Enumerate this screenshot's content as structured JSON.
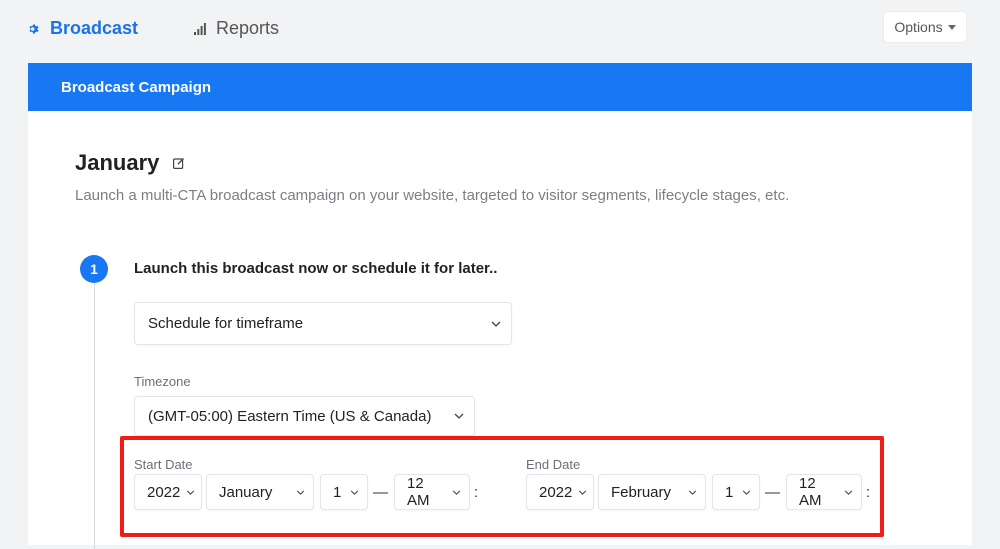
{
  "nav": {
    "broadcast_label": "Broadcast",
    "reports_label": "Reports",
    "options_label": "Options"
  },
  "card": {
    "header_title": "Broadcast Campaign",
    "page_title": "January",
    "subtitle": "Launch a multi-CTA broadcast campaign on your website, targeted to visitor segments, lifecycle stages, etc."
  },
  "step": {
    "number": "1",
    "label": "Launch this broadcast now or schedule it for later.."
  },
  "schedule": {
    "selected": "Schedule for timeframe"
  },
  "timezone": {
    "label": "Timezone",
    "selected": "(GMT-05:00) Eastern Time (US & Canada)"
  },
  "start_date": {
    "label": "Start Date",
    "year": "2022",
    "month": "January",
    "day": "1",
    "time": "12 AM"
  },
  "end_date": {
    "label": "End Date",
    "year": "2022",
    "month": "February",
    "day": "1",
    "time": "12 AM"
  },
  "separators": {
    "dash": "—",
    "colon": ":"
  },
  "colors": {
    "accent": "#1877f2",
    "highlight": "#f01c17"
  }
}
